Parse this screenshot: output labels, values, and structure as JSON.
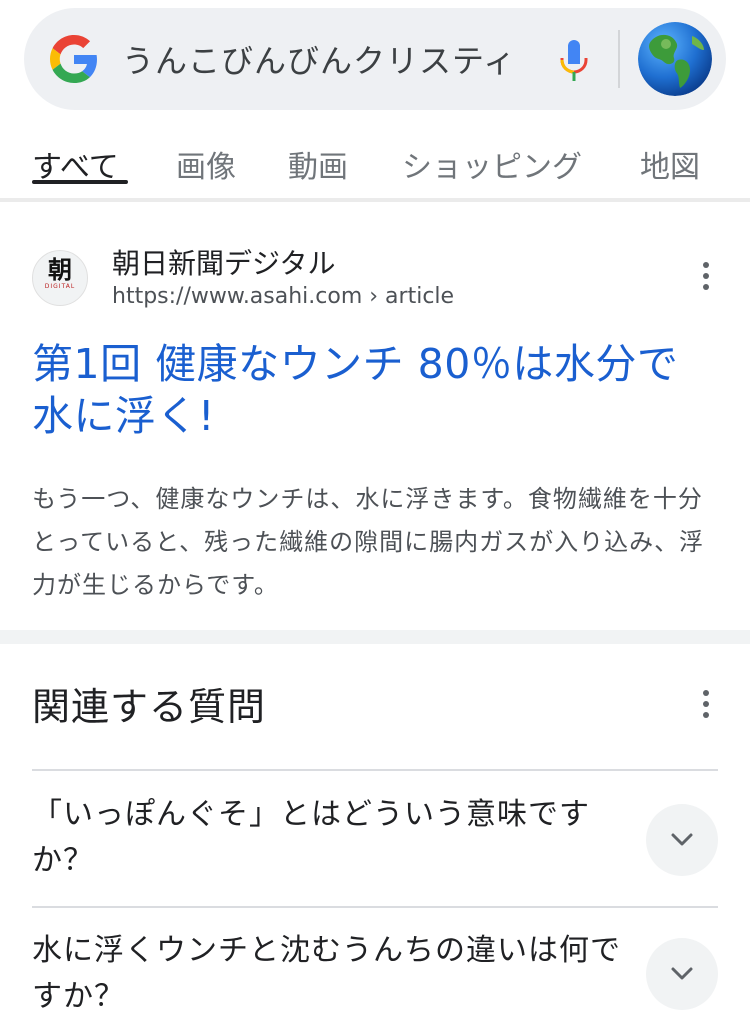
{
  "search": {
    "query": "うんこびんびんクリスティ",
    "logo_icon": "google-g-icon",
    "mic_icon": "microphone-icon",
    "avatar_icon": "globe-avatar-icon"
  },
  "tabs": [
    {
      "label": "すべて",
      "active": true
    },
    {
      "label": "画像",
      "active": false
    },
    {
      "label": "動画",
      "active": false
    },
    {
      "label": "ショッピング",
      "active": false
    },
    {
      "label": "地図",
      "active": false
    }
  ],
  "result": {
    "favicon_glyph": "朝",
    "favicon_sub": "DIGITAL",
    "site_name": "朝日新聞デジタル",
    "url": "https://www.asahi.com › article",
    "title": "第1回 健康なウンチ 80％は水分で水に浮く!",
    "snippet": "もう一つ、健康なウンチは、水に浮きます。食物繊維を十分とっていると、残った繊維の隙間に腸内ガスが入り込み、浮力が生じるからです。"
  },
  "related": {
    "title": "関連する質問",
    "questions": [
      {
        "text": "「いっぽんぐそ」とはどういう意味ですか？"
      },
      {
        "text": "水に浮くウンチと沈むうんちの違いは何ですか？"
      }
    ]
  },
  "colors": {
    "link_blue": "#1a5fd0",
    "search_bg": "#eef0f3",
    "text_primary": "#202124",
    "text_secondary": "#4d5156"
  }
}
